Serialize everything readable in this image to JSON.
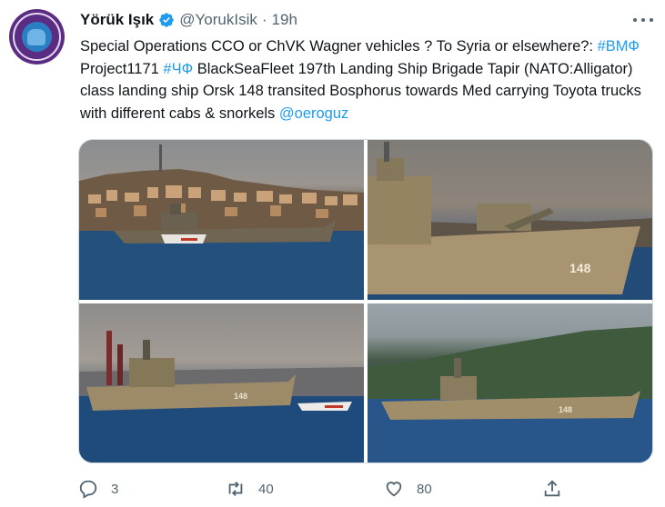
{
  "tweet": {
    "author_name": "Yörük Işık",
    "author_handle": "@YorukIsik",
    "separator": "·",
    "time": "19h",
    "text_segments": [
      {
        "text": "Special Operations CCO or ChVK Wagner vehicles ? To Syria or elsewhere?: ",
        "kind": "text"
      },
      {
        "text": "#ВМФ",
        "kind": "hashtag"
      },
      {
        "text": " Project1171 ",
        "kind": "text"
      },
      {
        "text": "#ЧФ",
        "kind": "hashtag"
      },
      {
        "text": " BlackSeaFleet 197th Landing Ship Brigade Tapir (NATO:Alligator) class landing ship Orsk 148 transited Bosphorus towards Med carrying Toyota trucks with different cabs & snorkels ",
        "kind": "text"
      },
      {
        "text": "@oeroguz",
        "kind": "mention"
      }
    ],
    "hull_number": "148"
  },
  "actions": {
    "reply_count": "3",
    "retweet_count": "40",
    "like_count": "80"
  },
  "icons": {
    "verified": "verified-badge-icon",
    "more": "more-icon",
    "reply": "reply-icon",
    "retweet": "retweet-icon",
    "like": "like-icon",
    "share": "share-icon"
  },
  "colors": {
    "link": "#1d9bf0",
    "secondary_text": "#536471",
    "primary_text": "#0f1419"
  }
}
